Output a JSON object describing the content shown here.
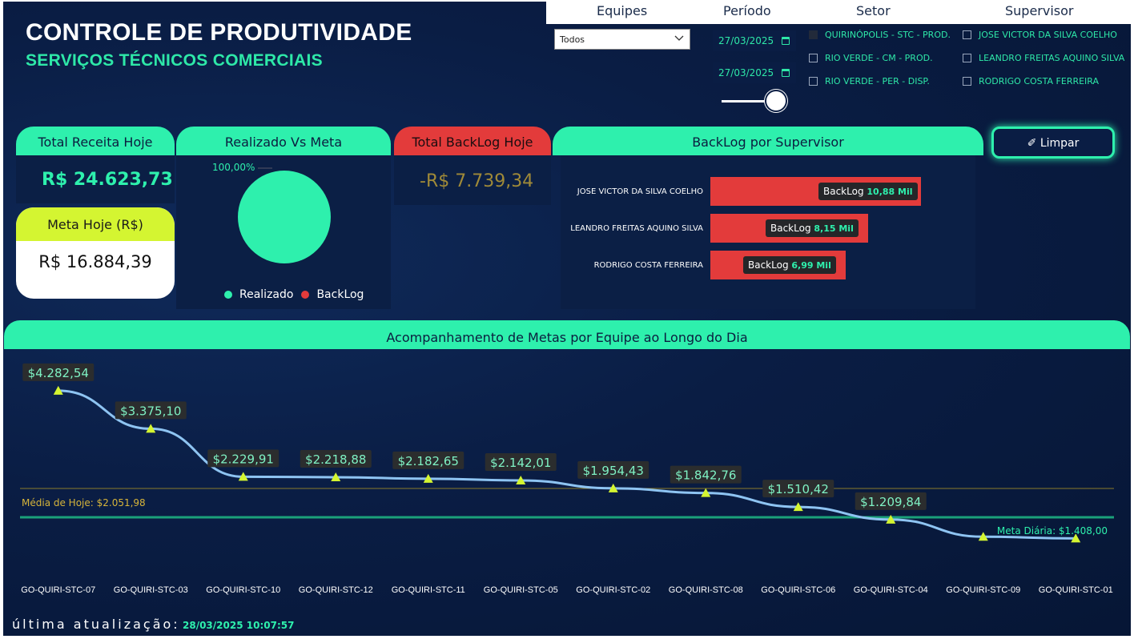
{
  "header": {
    "title": "CONTROLE DE PRODUTIVIDADE",
    "subtitle": "SERVIÇOS TÉCNICOS COMERCIAIS"
  },
  "filters": {
    "equipes_label": "Equipes",
    "periodo_label": "Período",
    "setor_label": "Setor",
    "supervisor_label": "Supervisor",
    "equipes_value": "Todos",
    "date_start": "27/03/2025",
    "date_end": "27/03/2025",
    "setor_options": [
      {
        "label": "QUIRINÓPOLIS - STC - PROD.",
        "checked": true
      },
      {
        "label": "RIO VERDE - CM - PROD.",
        "checked": false
      },
      {
        "label": "RIO VERDE - PER - DISP.",
        "checked": false
      }
    ],
    "supervisor_options": [
      {
        "label": "JOSE VICTOR DA SILVA COELHO",
        "checked": false
      },
      {
        "label": "LEANDRO FREITAS AQUINO SILVA",
        "checked": false
      },
      {
        "label": "RODRIGO COSTA FERREIRA",
        "checked": false
      }
    ]
  },
  "kpis": {
    "receita_title": "Total Receita Hoje",
    "receita_value": "R$ 24.623,73",
    "meta_title": "Meta Hoje (R$)",
    "meta_value": "R$ 16.884,39",
    "realizado_title": "Realizado Vs Meta",
    "realizado_pct": "100,00%",
    "backlog_title": "Total BackLog Hoje",
    "backlog_value": "-R$ 7.739,34",
    "legend_realizado": "Realizado",
    "legend_backlog": "BackLog"
  },
  "backlog_supervisor": {
    "title": "BackLog por Supervisor",
    "tip_label": "BackLog",
    "rows": [
      {
        "name": "JOSE VICTOR DA SILVA COELHO",
        "value": 10.88,
        "display": "10,88 Mil"
      },
      {
        "name": "LEANDRO FREITAS AQUINO SILVA",
        "value": 8.15,
        "display": "8,15 Mil"
      },
      {
        "name": "RODRIGO COSTA FERREIRA",
        "value": 6.99,
        "display": "6,99 Mil"
      }
    ]
  },
  "actions": {
    "limpar_label": "Limpar"
  },
  "footer": {
    "label": "última atualização:",
    "value": "28/03/2025 10:07:57"
  },
  "colors": {
    "accent": "#2ef0ad",
    "backlog": "#e33b3b",
    "meta_head": "#d4f531",
    "line": "#8ec4f2",
    "marker": "#d4f531",
    "media_line": "#8a7a2a",
    "meta_line": "#1aa17a"
  },
  "chart_data": {
    "type": "line",
    "title": "Acompanhamento de Metas por  Equipe ao Longo do Dia",
    "categories": [
      "GO-QUIRI-STC-07",
      "GO-QUIRI-STC-03",
      "GO-QUIRI-STC-10",
      "GO-QUIRI-STC-12",
      "GO-QUIRI-STC-11",
      "GO-QUIRI-STC-05",
      "GO-QUIRI-STC-02",
      "GO-QUIRI-STC-08",
      "GO-QUIRI-STC-06",
      "GO-QUIRI-STC-04",
      "GO-QUIRI-STC-09",
      "GO-QUIRI-STC-01"
    ],
    "values": [
      4282.54,
      3375.1,
      2229.91,
      2218.88,
      2182.65,
      2142.01,
      1954.43,
      1842.76,
      1510.42,
      1209.84,
      800,
      760
    ],
    "labels": [
      "$4.282,54",
      "$3.375,10",
      "$2.229,91",
      "$2.218,88",
      "$2.182,65",
      "$2.142,01",
      "$1.954,43",
      "$1.842,76",
      "$1.510,42",
      "$1.209,84",
      "",
      ""
    ],
    "reference_lines": [
      {
        "label": "Média de Hoje: $2.051,98",
        "value": 2051.98
      },
      {
        "label": "Meta Diária: $1.408,00",
        "value": 1408.0
      }
    ],
    "ylim": [
      500,
      4700
    ]
  }
}
